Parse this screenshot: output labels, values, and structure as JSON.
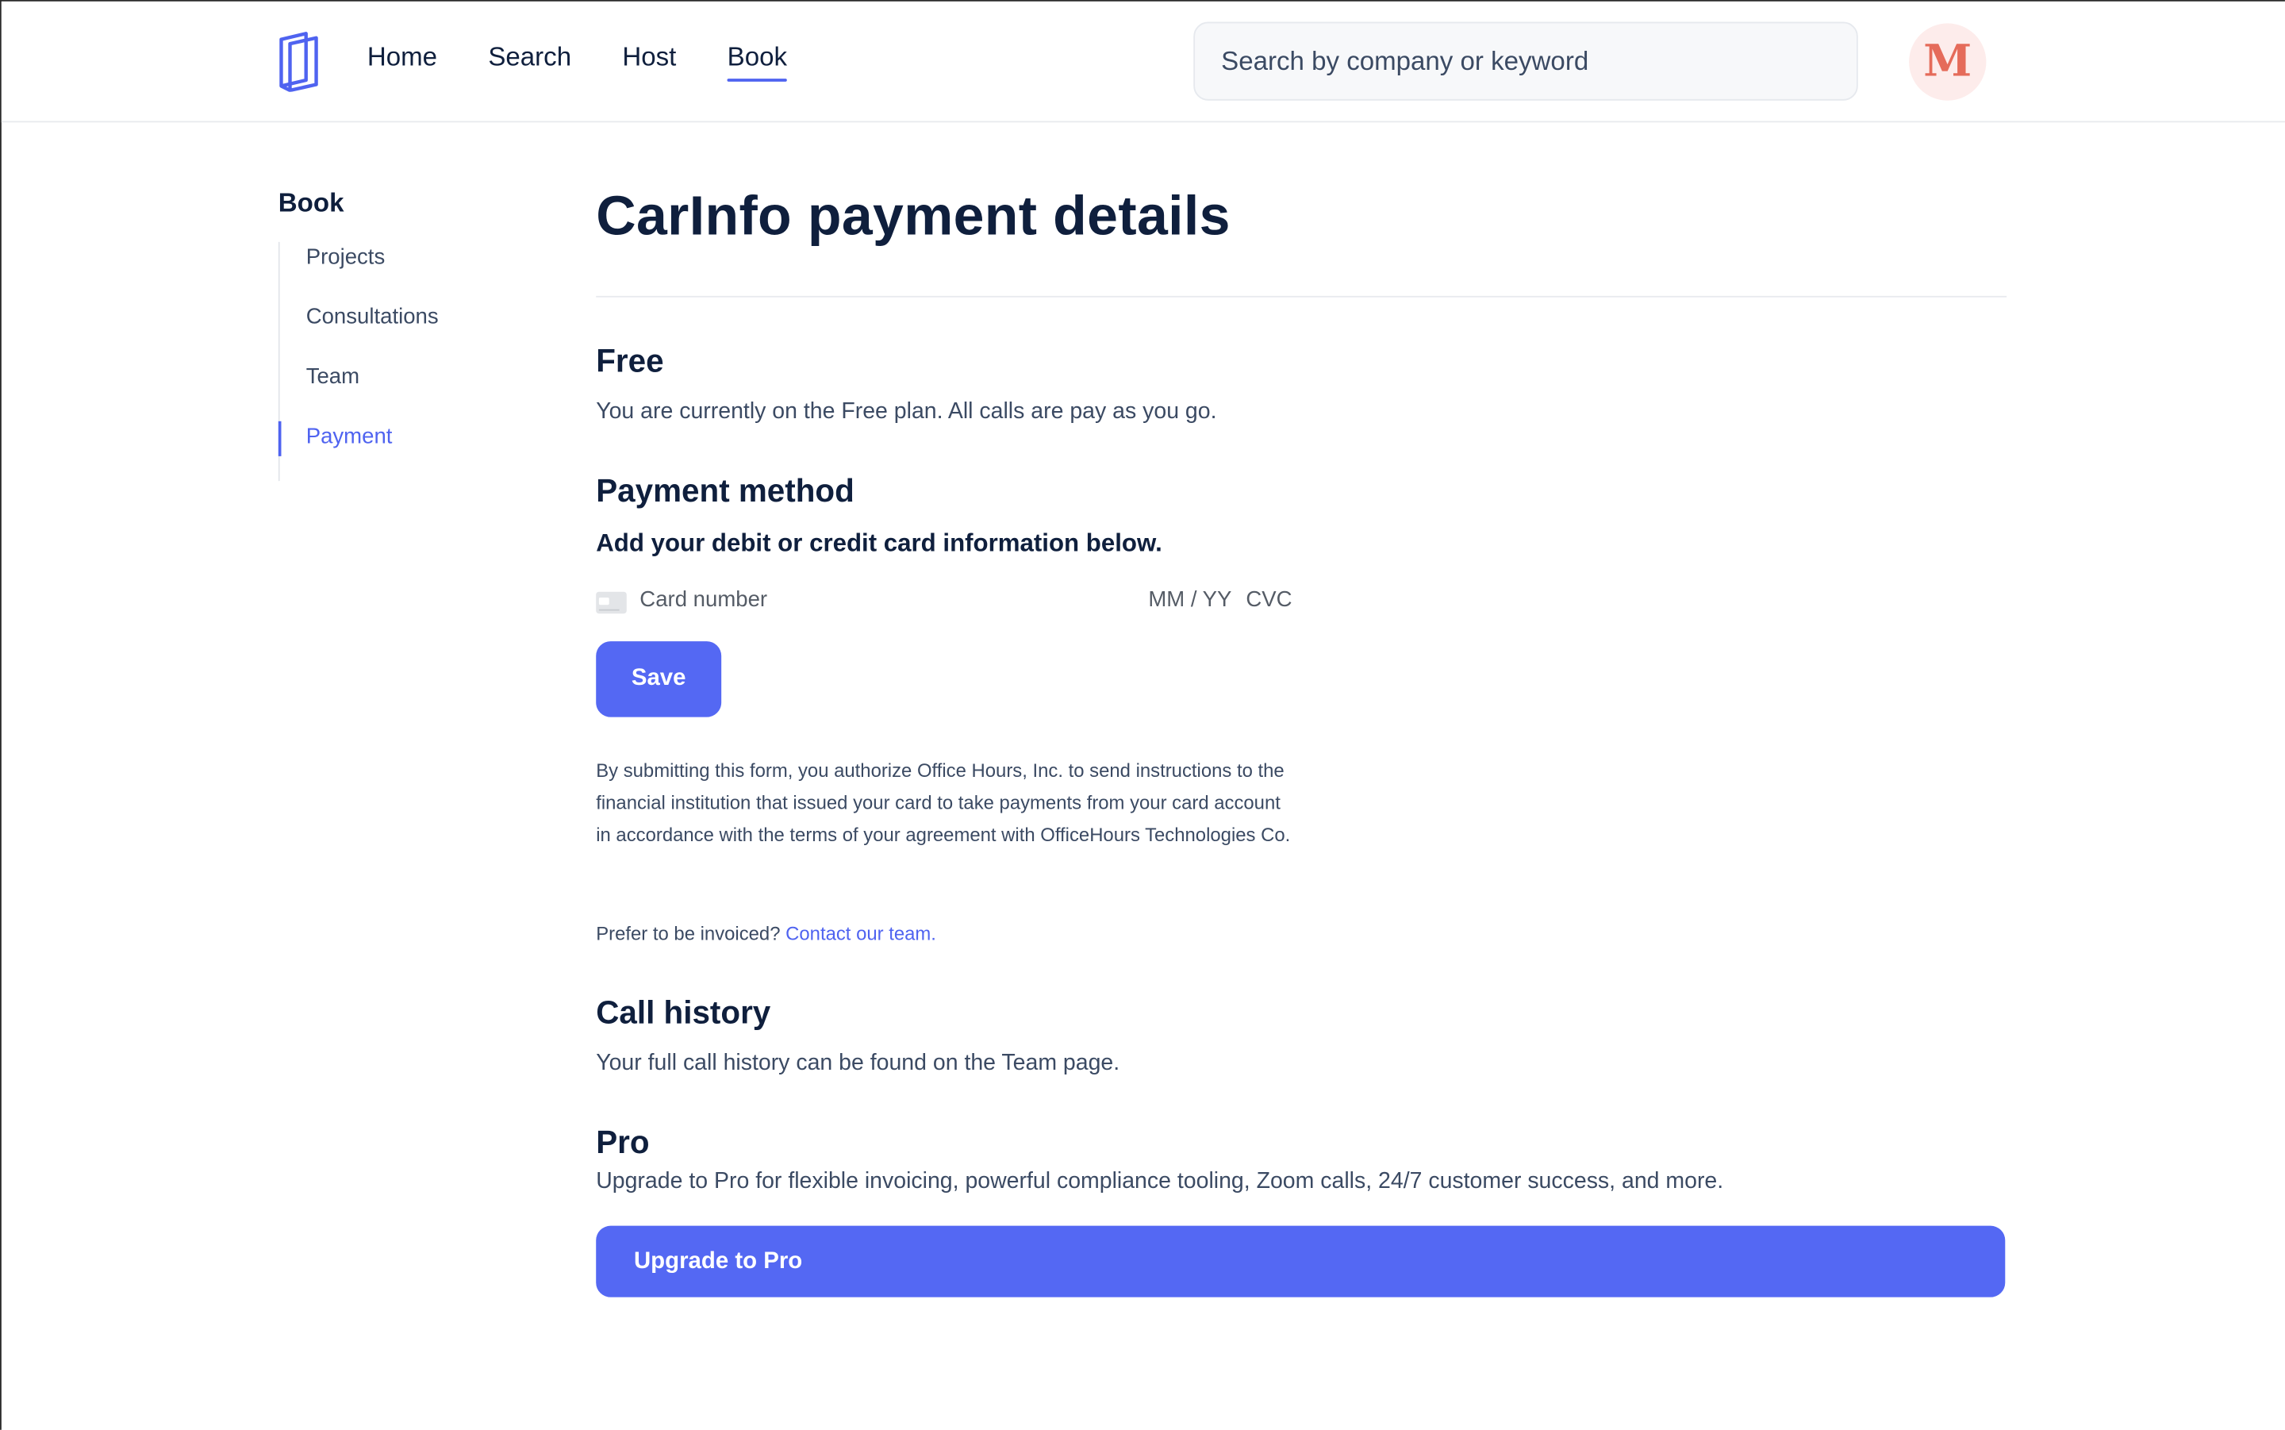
{
  "header": {
    "logo_icon": "book-logo-icon",
    "nav": [
      {
        "label": "Home",
        "active": false
      },
      {
        "label": "Search",
        "active": false
      },
      {
        "label": "Host",
        "active": false
      },
      {
        "label": "Book",
        "active": true
      }
    ],
    "search_placeholder": "Search by company or keyword",
    "avatar_letter": "M"
  },
  "sidebar": {
    "title": "Book",
    "items": [
      {
        "label": "Projects",
        "active": false
      },
      {
        "label": "Consultations",
        "active": false
      },
      {
        "label": "Team",
        "active": false
      },
      {
        "label": "Payment",
        "active": true
      }
    ]
  },
  "main": {
    "title": "CarInfo payment details",
    "free": {
      "heading": "Free",
      "text": "You are currently on the Free plan. All calls are pay as you go."
    },
    "payment_method": {
      "heading": "Payment method",
      "subheading": "Add your debit or credit card information below.",
      "card_icon": "credit-card-icon",
      "card_number_placeholder": "Card number",
      "expiry_placeholder": "MM / YY",
      "cvc_placeholder": "CVC",
      "save_label": "Save",
      "legal_text": "By submitting this form, you authorize Office Hours, Inc. to send instructions to the financial institution that issued your card to take payments from your card account in accordance with the terms of your agreement with OfficeHours Technologies Co.",
      "invoice_prefix": "Prefer to be invoiced?",
      "invoice_link": "Contact our team."
    },
    "call_history": {
      "heading": "Call history",
      "text": "Your full call history can be found on the Team page."
    },
    "pro": {
      "heading": "Pro",
      "text": "Upgrade to Pro for flexible invoicing, powerful compliance tooling, Zoom calls, 24/7 customer success, and more.",
      "button_label": "Upgrade to Pro"
    }
  },
  "colors": {
    "accent": "#5468f3",
    "text_dark": "#0f1f3d",
    "text_body": "#3b4a63",
    "avatar_bg": "#fdeceb",
    "avatar_fg": "#e56b5a"
  }
}
